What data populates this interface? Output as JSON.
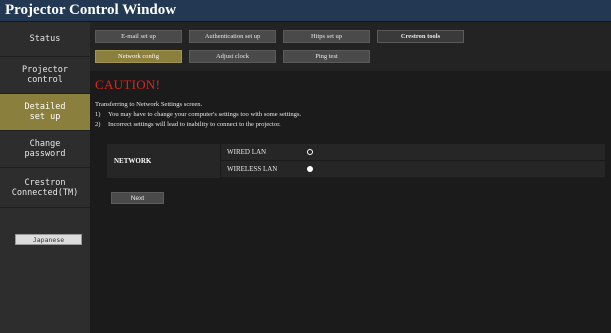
{
  "window": {
    "title": "Projector Control Window"
  },
  "sidebar": {
    "items": [
      {
        "label": "Status"
      },
      {
        "label": "Projector\ncontrol"
      },
      {
        "label": "Detailed\nset up"
      },
      {
        "label": "Change\npassword"
      },
      {
        "label": "Crestron\nConnected(TM)"
      }
    ],
    "active_index": 2,
    "language_button": "Japanese"
  },
  "tabs": {
    "row1": [
      "E-mail set up",
      "Authentication set up",
      "Https set up",
      "Crestron tools"
    ],
    "row2": [
      "Network config",
      "Adjust clock",
      "Ping test"
    ],
    "active": "Network config"
  },
  "main": {
    "caution": "CAUTION!",
    "intro": "Transferring to Network Settings screen.",
    "notes": [
      {
        "num": "1)",
        "text": "You may have to change your computer's settings too with some settings."
      },
      {
        "num": "2)",
        "text": "Incorrect settings will lead to inability to connect to the projector."
      }
    ],
    "network": {
      "label": "NETWORK",
      "options": [
        {
          "label": "WIRED LAN",
          "selected": false
        },
        {
          "label": "WIRELESS LAN",
          "selected": true
        }
      ]
    },
    "next_button": "Next"
  },
  "colors": {
    "titlebar": "#233852",
    "active_accent": "#8a7f3c",
    "caution": "#e0241d",
    "sidebar_bg": "#2d2d2d",
    "main_bg": "#1b1b1b"
  }
}
